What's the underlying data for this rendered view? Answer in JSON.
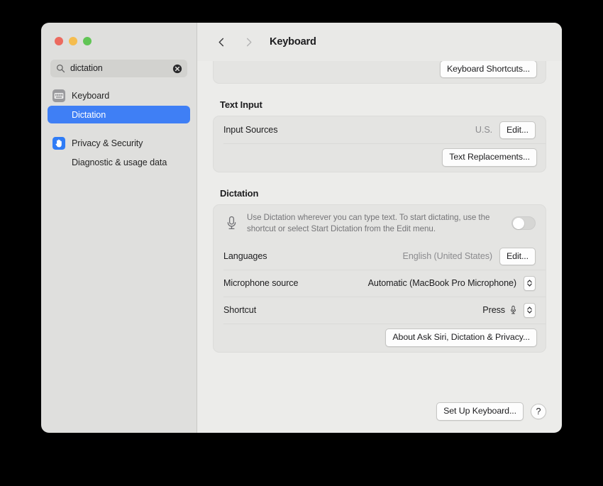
{
  "window": {
    "traffic_lights": {
      "close_color": "#ec6a5f",
      "minimize_color": "#f5bd4f",
      "zoom_color": "#61c555"
    }
  },
  "search": {
    "value": "dictation",
    "placeholder": "Search",
    "icon": "search-icon",
    "clear_icon": "clear-icon"
  },
  "sidebar": {
    "items": [
      {
        "label": "Keyboard",
        "icon": "keyboard-icon",
        "type": "parent",
        "selected": false
      },
      {
        "label": "Dictation",
        "icon": null,
        "type": "child",
        "selected": true
      },
      {
        "label": "Privacy & Security",
        "icon": "hand-icon",
        "type": "parent",
        "selected": false
      },
      {
        "label": "Diagnostic & usage data",
        "icon": null,
        "type": "child",
        "selected": false
      }
    ],
    "selected_accent": "#3f7ff5"
  },
  "toolbar": {
    "title": "Keyboard",
    "back_icon": "chevron-left-icon",
    "forward_icon": "chevron-right-icon",
    "back_enabled": true,
    "forward_enabled": false
  },
  "main": {
    "keyboard_card": {
      "shortcuts_button": "Keyboard Shortcuts..."
    },
    "text_input": {
      "title": "Text Input",
      "rows": [
        {
          "label": "Input Sources",
          "value": "U.S.",
          "button": "Edit..."
        }
      ],
      "text_replacements_button": "Text Replacements..."
    },
    "dictation": {
      "title": "Dictation",
      "description": "Use Dictation wherever you can type text. To start dictating, use the shortcut or select Start Dictation from the Edit menu.",
      "mic_icon": "microphone-icon",
      "toggle": {
        "name": "dictation-toggle",
        "on": false
      },
      "rows": [
        {
          "label": "Languages",
          "value": "English (United States)",
          "control": "button",
          "button": "Edit..."
        },
        {
          "label": "Microphone source",
          "value": "Automatic (MacBook Pro Microphone)",
          "control": "stepper"
        },
        {
          "label": "Shortcut",
          "value": "Press",
          "value_icon": "microphone-icon",
          "control": "stepper"
        }
      ],
      "privacy_button": "About Ask Siri, Dictation & Privacy..."
    }
  },
  "footer": {
    "setup_button": "Set Up Keyboard...",
    "help_button": "?",
    "help_icon": "question-mark-icon"
  }
}
